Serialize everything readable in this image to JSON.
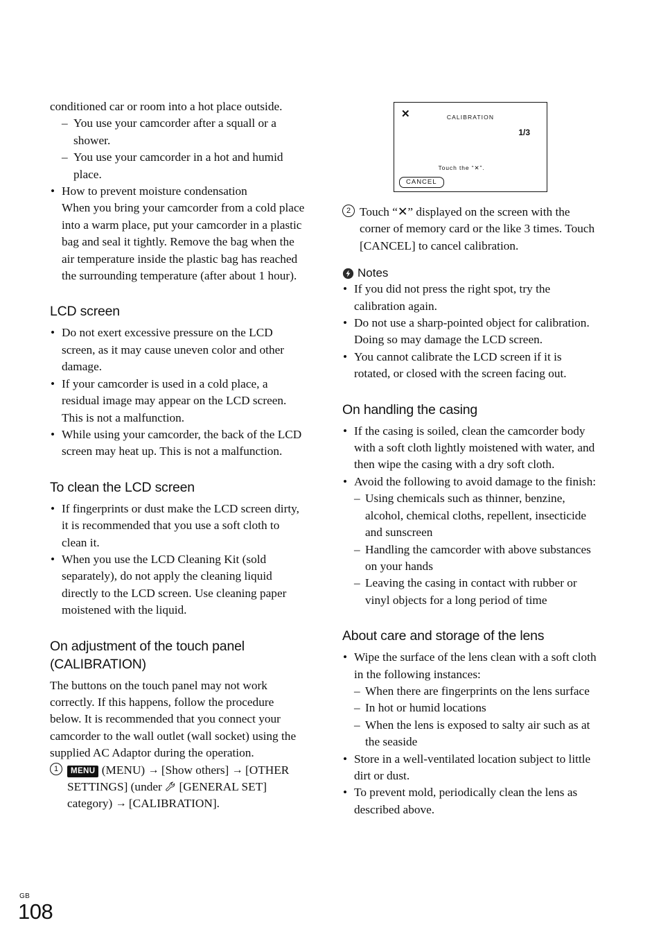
{
  "page": {
    "folio_label": "GB",
    "folio_number": "108"
  },
  "left_column": {
    "continued_paragraph": "conditioned car or room into a hot place outside.",
    "continued_dashes": [
      "You use your camcorder after a squall or a shower.",
      "You use your camcorder in a hot and humid place."
    ],
    "condensation_bullet_title": "How to prevent moisture condensation",
    "condensation_bullet_body": "When you bring your camcorder from a cold place into a warm place, put your camcorder in a plastic bag and seal it tightly. Remove the bag when the air temperature inside the plastic bag has reached the surrounding temperature (after about 1 hour).",
    "lcd_screen": {
      "heading": "LCD screen",
      "bullets": [
        "Do not exert excessive pressure on the LCD screen, as it may cause uneven color and other damage.",
        "If your camcorder is used in a cold place, a residual image may appear on the LCD screen. This is not a malfunction.",
        "While using your camcorder, the back of the LCD screen may heat up. This is not a malfunction."
      ]
    },
    "clean_lcd": {
      "heading": "To clean the LCD screen",
      "bullets": [
        "If fingerprints or dust make the LCD screen dirty, it is recommended that you use a soft cloth to clean it.",
        "When you use the LCD Cleaning Kit (sold separately), do not apply the cleaning liquid directly to the LCD screen. Use cleaning paper moistened with the liquid."
      ]
    },
    "calibration": {
      "heading_line1": "On adjustment of the touch panel",
      "heading_line2": "(CALIBRATION)",
      "intro": "The buttons on the touch panel may not work correctly. If this happens, follow the procedure below. It is recommended that you connect your camcorder to the wall outlet (wall socket) using the supplied AC Adaptor during the operation.",
      "step1": {
        "number": "1",
        "menu_badge": "MENU",
        "text_a": "(MENU)",
        "arrow": "→",
        "text_b": "[Show others]",
        "text_c": "[OTHER SETTINGS] (under",
        "text_d": "[GENERAL SET] category)",
        "text_e": "[CALIBRATION]."
      }
    }
  },
  "lcd_mock": {
    "close_glyph": "✕",
    "title": "CALIBRATION",
    "counter": "1/3",
    "instruction": "Touch the “✕”.",
    "cancel_label": "CANCEL"
  },
  "right_column": {
    "step2": {
      "number": "2",
      "text": "Touch “✕” displayed on the screen with the corner of memory card or the like 3 times. Touch [CANCEL] to cancel calibration."
    },
    "notes": {
      "label": "Notes",
      "bullets": [
        "If you did not press the right spot, try the calibration again.",
        "Do not use a sharp-pointed object for calibration. Doing so may damage the LCD screen.",
        "You cannot calibrate the LCD screen if it is rotated, or closed with the screen facing out."
      ]
    },
    "casing": {
      "heading": "On handling the casing",
      "bullet1": "If the casing is soiled, clean the camcorder body with a soft cloth lightly moistened with water, and then wipe the casing with a dry soft cloth.",
      "bullet2": "Avoid the following to avoid damage to the finish:",
      "sub_dashes": [
        "Using chemicals such as thinner, benzine, alcohol, chemical cloths, repellent, insecticide and sunscreen",
        "Handling the camcorder with above substances on your hands",
        "Leaving the casing in contact with rubber or vinyl objects for a long period of time"
      ]
    },
    "lens": {
      "heading": "About care and storage of the lens",
      "bullet1": "Wipe the surface of the lens clean with a soft cloth in the following instances:",
      "sub_dashes": [
        "When there are fingerprints on the lens surface",
        "In hot or humid locations",
        "When the lens is exposed to salty air such as at the seaside"
      ],
      "bullet2": "Store in a well-ventilated location subject to little dirt or dust.",
      "bullet3": "To prevent mold, periodically clean the lens as described above."
    }
  },
  "icons": {
    "bullet": "•",
    "dash": "–",
    "notes_icon": "lightning-bolt-circle-icon",
    "wrench_icon": "wrench-icon"
  }
}
